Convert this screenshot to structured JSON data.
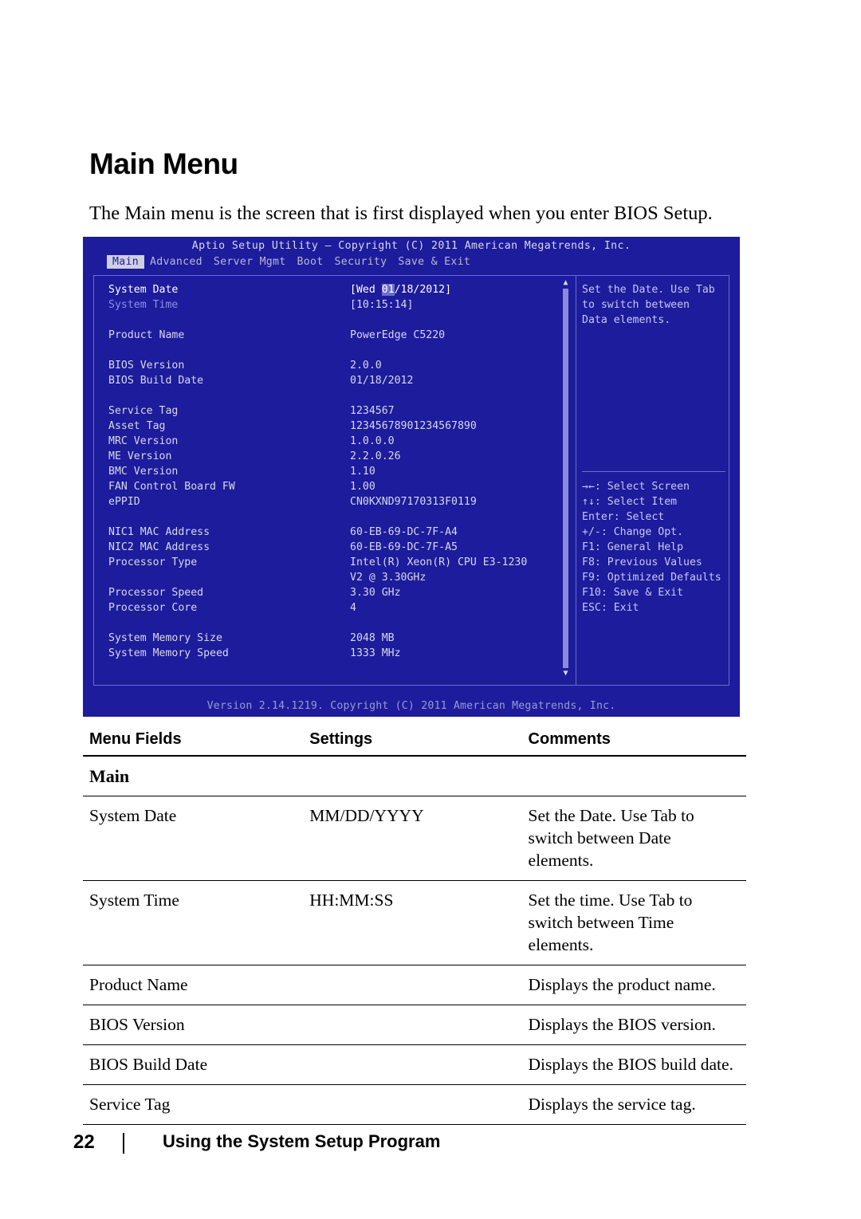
{
  "heading": "Main Menu",
  "intro": "The Main menu is the screen that is first displayed when you enter BIOS Setup.",
  "bios": {
    "title": "Aptio Setup Utility – Copyright (C) 2011 American Megatrends, Inc.",
    "tabs": [
      "Main",
      "Advanced",
      "Server Mgmt",
      "Boot",
      "Security",
      "Save & Exit"
    ],
    "active_tab": "Main",
    "rows": [
      {
        "label": "System Date",
        "value": "[Wed 01/18/2012]",
        "style": "selected-date"
      },
      {
        "label": "System Time",
        "value": "[10:15:14]",
        "style": "highlight-label"
      },
      {
        "label": "",
        "value": "",
        "style": "spacer"
      },
      {
        "label": "Product Name",
        "value": "PowerEdge C5220",
        "style": "normal"
      },
      {
        "label": "",
        "value": "",
        "style": "spacer"
      },
      {
        "label": "BIOS Version",
        "value": "2.0.0",
        "style": "normal"
      },
      {
        "label": "BIOS Build Date",
        "value": "01/18/2012",
        "style": "normal"
      },
      {
        "label": "",
        "value": "",
        "style": "spacer"
      },
      {
        "label": "Service Tag",
        "value": "1234567",
        "style": "normal"
      },
      {
        "label": "Asset Tag",
        "value": "12345678901234567890",
        "style": "normal"
      },
      {
        "label": "MRC Version",
        "value": "1.0.0.0",
        "style": "normal"
      },
      {
        "label": "ME Version",
        "value": "2.2.0.26",
        "style": "normal"
      },
      {
        "label": "BMC Version",
        "value": "1.10",
        "style": "normal"
      },
      {
        "label": "FAN Control Board FW",
        "value": "1.00",
        "style": "normal"
      },
      {
        "label": "ePPID",
        "value": "CN0KXND97170313F0119",
        "style": "normal"
      },
      {
        "label": "",
        "value": "",
        "style": "spacer"
      },
      {
        "label": "NIC1 MAC Address",
        "value": "60-EB-69-DC-7F-A4",
        "style": "normal"
      },
      {
        "label": "NIC2 MAC Address",
        "value": "60-EB-69-DC-7F-A5",
        "style": "normal"
      },
      {
        "label": "Processor Type",
        "value": "Intel(R) Xeon(R) CPU E3-1230",
        "style": "normal"
      },
      {
        "label": "",
        "value": "V2 @ 3.30GHz",
        "style": "normal"
      },
      {
        "label": "Processor Speed",
        "value": "3.30 GHz",
        "style": "normal"
      },
      {
        "label": "Processor Core",
        "value": "4",
        "style": "normal"
      },
      {
        "label": "",
        "value": "",
        "style": "spacer"
      },
      {
        "label": "System Memory Size",
        "value": "2048 MB",
        "style": "normal"
      },
      {
        "label": "System Memory Speed",
        "value": "1333 MHz",
        "style": "normal"
      }
    ],
    "help": [
      "Set the Date. Use Tab",
      "to switch between",
      "Data elements."
    ],
    "keys": [
      "→←: Select Screen",
      "↑↓: Select Item",
      "Enter: Select",
      "+/-: Change Opt.",
      "F1: General Help",
      "F8: Previous Values",
      "F9: Optimized Defaults",
      "F10: Save & Exit",
      "ESC: Exit"
    ],
    "footer": "Version 2.14.1219. Copyright (C) 2011 American Megatrends, Inc."
  },
  "table": {
    "headers": [
      "Menu Fields",
      "Settings",
      "Comments"
    ],
    "section": "Main",
    "rows": [
      {
        "field": "System Date",
        "settings": "MM/DD/YYYY",
        "comments": "Set the Date. Use Tab to switch between Date elements."
      },
      {
        "field": "System Time",
        "settings": "HH:MM:SS",
        "comments": "Set the time. Use Tab to switch between Time elements."
      },
      {
        "field": "Product Name",
        "settings": "",
        "comments": "Displays the product name."
      },
      {
        "field": "BIOS Version",
        "settings": "",
        "comments": "Displays the BIOS version."
      },
      {
        "field": "BIOS Build Date",
        "settings": "",
        "comments": "Displays the BIOS build date."
      },
      {
        "field": "Service Tag",
        "settings": "",
        "comments": "Displays the service tag."
      }
    ]
  },
  "footer": {
    "page_number": "22",
    "text": "Using the System Setup Program"
  }
}
